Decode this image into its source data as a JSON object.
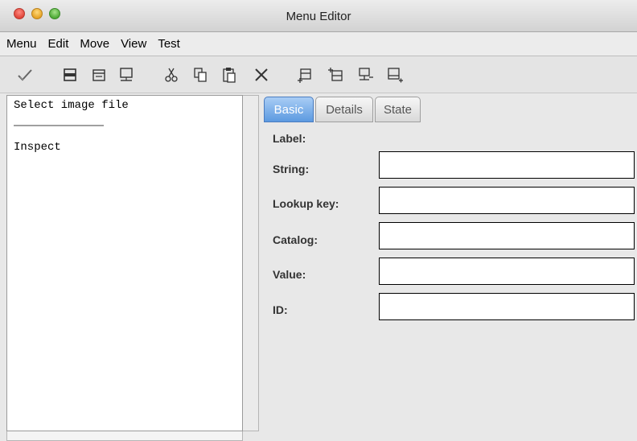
{
  "window": {
    "title": "Menu Editor"
  },
  "menubar": {
    "items": [
      "Menu",
      "Edit",
      "Move",
      "View",
      "Test"
    ]
  },
  "toolbar": {
    "icons": [
      "checkmark-icon",
      "insert-item-icon",
      "insert-item-before-icon",
      "insert-item-after-icon",
      "cut-icon",
      "copy-icon",
      "paste-icon",
      "delete-icon",
      "add-submenu-icon",
      "add-submenu-before-icon",
      "add-submenu-below-icon",
      "add-submenu-after-icon"
    ]
  },
  "left_panel": {
    "items": [
      "Select image file",
      "Inspect"
    ]
  },
  "tabs": [
    "Basic",
    "Details",
    "State"
  ],
  "active_tab": "Basic",
  "form": {
    "label": "Label:",
    "string": "String:",
    "lookup_key": "Lookup key:",
    "catalog": "Catalog:",
    "value": "Value:",
    "id": "ID:"
  }
}
